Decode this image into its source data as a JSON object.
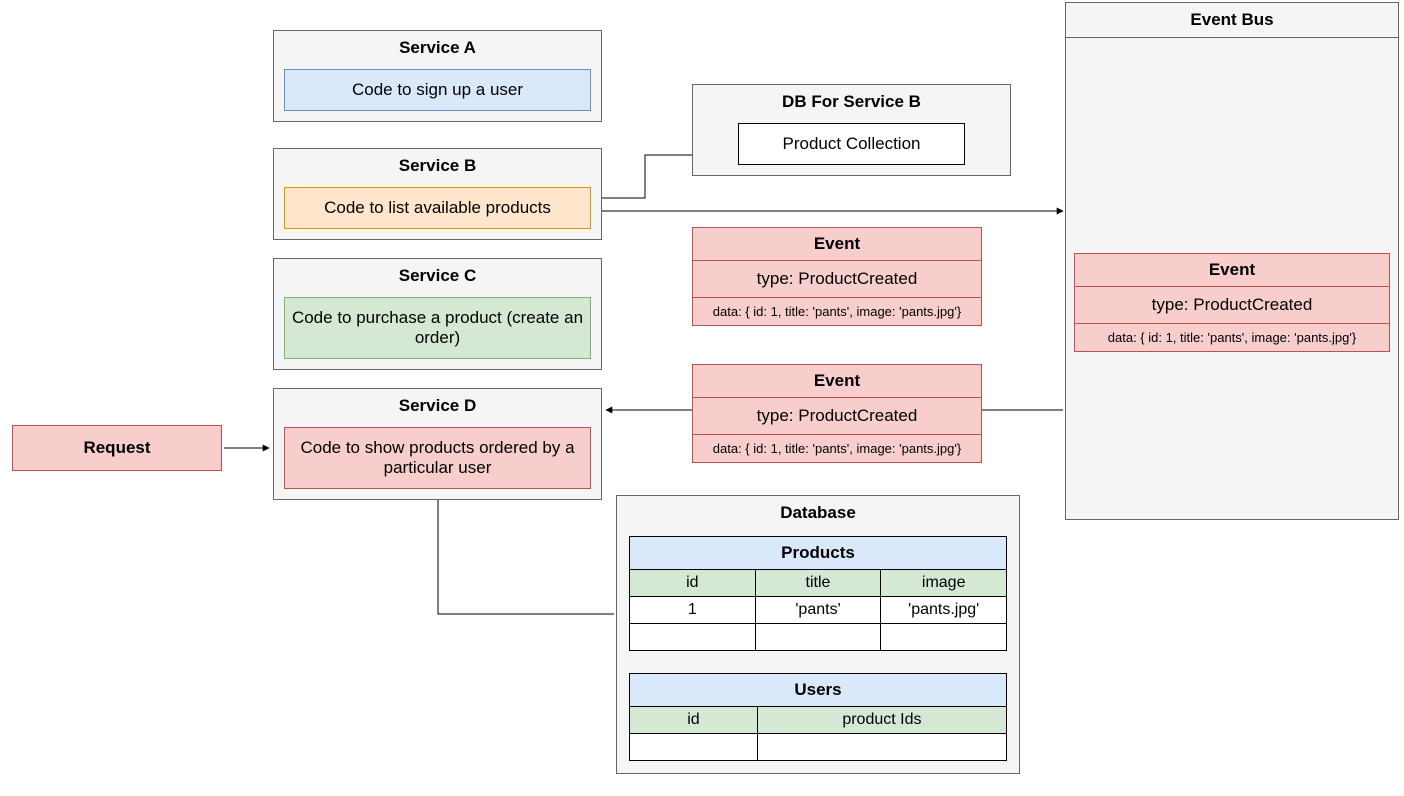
{
  "serviceA": {
    "title": "Service A",
    "code": "Code to sign up a user"
  },
  "serviceB": {
    "title": "Service B",
    "code": "Code to list available products"
  },
  "serviceC": {
    "title": "Service C",
    "code": "Code to purchase a product (create an order)"
  },
  "serviceD": {
    "title": "Service D",
    "code": "Code to show products ordered by a particular user"
  },
  "request": {
    "label": "Request"
  },
  "dbForB": {
    "title": "DB For Service B",
    "inner": "Product Collection"
  },
  "event1": {
    "title": "Event",
    "type": "type: ProductCreated",
    "data": "data: { id: 1, title: 'pants', image: 'pants.jpg'}"
  },
  "event2": {
    "title": "Event",
    "type": "type: ProductCreated",
    "data": "data: { id: 1, title: 'pants', image: 'pants.jpg'}"
  },
  "eventBus": {
    "title": "Event Bus",
    "event": {
      "title": "Event",
      "type": "type: ProductCreated",
      "data": "data: { id: 1, title: 'pants', image: 'pants.jpg'}"
    }
  },
  "database": {
    "title": "Database",
    "products": {
      "title": "Products",
      "headers": [
        "id",
        "title",
        "image"
      ],
      "row": [
        "1",
        "'pants'",
        "'pants.jpg'"
      ]
    },
    "users": {
      "title": "Users",
      "headers": [
        "id",
        "product Ids"
      ]
    }
  }
}
